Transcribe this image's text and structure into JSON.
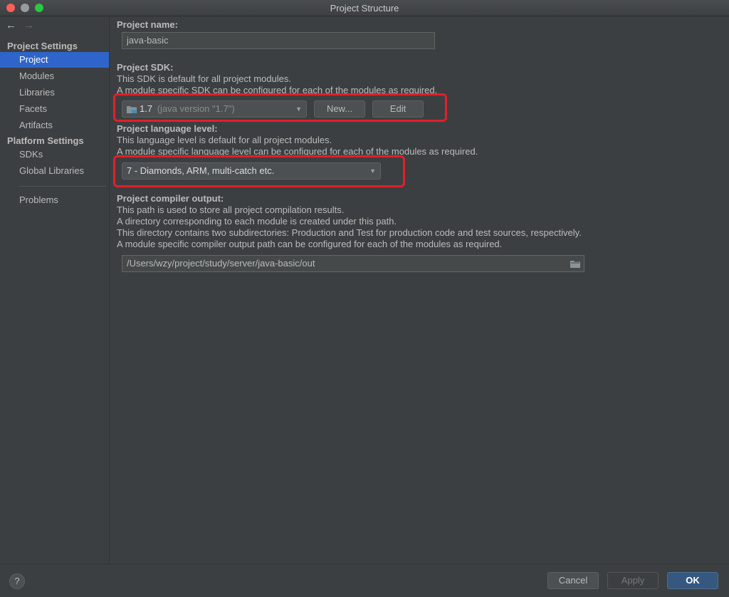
{
  "window": {
    "title": "Project Structure"
  },
  "sidebar": {
    "project_settings_header": "Project Settings",
    "items_project": [
      "Project",
      "Modules",
      "Libraries",
      "Facets",
      "Artifacts"
    ],
    "platform_settings_header": "Platform Settings",
    "items_platform": [
      "SDKs",
      "Global Libraries"
    ],
    "problems": "Problems",
    "back_arrow": "←",
    "forward_arrow": "→"
  },
  "project": {
    "name_label": "Project name:",
    "name_value": "java-basic",
    "sdk_label": "Project SDK:",
    "sdk_desc_1": "This SDK is default for all project modules.",
    "sdk_desc_2": "A module specific SDK can be configured for each of the modules as required.",
    "sdk_value": "1.7",
    "sdk_version": "(java version \"1.7\")",
    "new_button": "New...",
    "edit_button": "Edit",
    "lang_label": "Project language level:",
    "lang_desc_1": "This language level is default for all project modules.",
    "lang_desc_2": "A module specific language level can be configured for each of the modules as required.",
    "lang_value": "7 - Diamonds, ARM, multi-catch etc.",
    "output_label": "Project compiler output:",
    "output_desc_1": "This path is used to store all project compilation results.",
    "output_desc_2": "A directory corresponding to each module is created under this path.",
    "output_desc_3": "This directory contains two subdirectories: Production and Test for production code and test sources, respectively.",
    "output_desc_4": "A module specific compiler output path can be configured for each of the modules as required.",
    "output_path": "/Users/wzy/project/study/server/java-basic/out"
  },
  "footer": {
    "help": "?",
    "cancel": "Cancel",
    "apply": "Apply",
    "ok": "OK"
  },
  "colors": {
    "background": "#3c3f41",
    "selection": "#2f65ca",
    "highlight_box": "#e0202a",
    "default_button": "#365880"
  }
}
